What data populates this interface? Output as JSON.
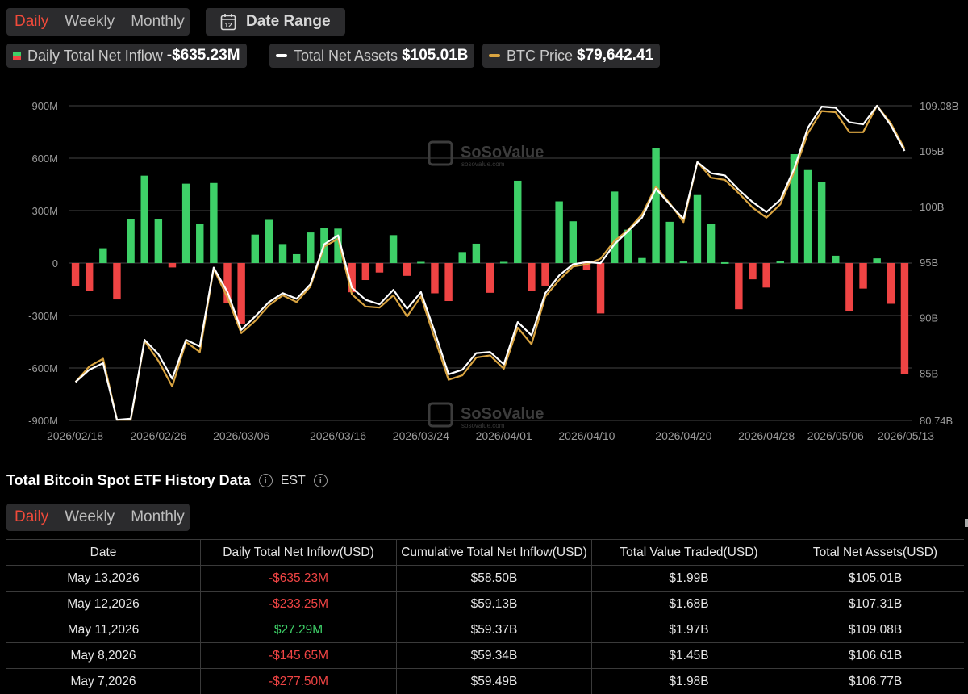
{
  "top_tabs": {
    "items": [
      "Daily",
      "Weekly",
      "Monthly"
    ],
    "active": "Daily"
  },
  "date_range": {
    "label": "Date Range",
    "icon": "calendar-icon",
    "icon_text": "12"
  },
  "legend": {
    "inflow": {
      "label": "Daily Total Net Inflow",
      "value": "-$635.23M"
    },
    "assets": {
      "label": "Total Net Assets",
      "value": "$105.01B"
    },
    "btc": {
      "label": "BTC Price",
      "value": "$79,642.41"
    }
  },
  "watermark": {
    "brand": "SoSoValue",
    "url": "sosovalue.com"
  },
  "colors": {
    "positive": "#3ed068",
    "negative": "#ef4444",
    "assets_line": "#ffffff",
    "btc_line": "#d9a441",
    "grid": "#444444"
  },
  "chart_data": {
    "type": "bar",
    "combo": "bars with two lines on secondary axis",
    "x_tick_labels": [
      "2026/02/18",
      "2026/02/26",
      "2026/03/06",
      "2026/03/16",
      "2026/03/24",
      "2026/04/01",
      "2026/04/10",
      "2026/04/20",
      "2026/04/28",
      "2026/05/06",
      "2026/05/13"
    ],
    "y_left_ticks": [
      "900M",
      "600M",
      "300M",
      "0",
      "-300M",
      "-600M",
      "-900M"
    ],
    "y_right_ticks": [
      "109.08B",
      "105B",
      "100B",
      "95B",
      "90B",
      "85B",
      "80.74B"
    ],
    "y_left_range_millions": [
      -900,
      900
    ],
    "y_right_range_billions": [
      80.74,
      109.08
    ],
    "grid": true,
    "series": [
      {
        "name": "Daily Total Net Inflow",
        "kind": "bar",
        "unit": "M USD",
        "values": [
          -133,
          -158,
          85,
          -208,
          253,
          500,
          251,
          -25,
          454,
          225,
          458,
          -229,
          -346,
          163,
          247,
          109,
          51,
          175,
          202,
          197,
          -167,
          -97,
          -54,
          160,
          -73,
          7,
          -173,
          -217,
          63,
          111,
          -170,
          7,
          471,
          -160,
          -129,
          353,
          239,
          -38,
          -288,
          409,
          191,
          29,
          658,
          236,
          9,
          389,
          224,
          5,
          -264,
          -93,
          -140,
          10,
          623,
          532,
          463,
          42,
          -277,
          -146,
          27,
          -233,
          -635
        ]
      },
      {
        "name": "Total Net Assets",
        "kind": "line",
        "unit": "B USD",
        "values": [
          84.2,
          85.3,
          85.9,
          80.8,
          80.9,
          88.0,
          86.7,
          84.5,
          88.0,
          87.4,
          94.5,
          92.3,
          88.9,
          90.1,
          91.4,
          92.2,
          91.7,
          93.0,
          96.6,
          97.4,
          92.7,
          91.6,
          91.2,
          92.5,
          90.8,
          92.3,
          88.7,
          84.9,
          85.3,
          86.8,
          86.9,
          85.8,
          89.6,
          88.4,
          92.2,
          93.8,
          94.8,
          95.0,
          94.9,
          96.6,
          97.8,
          99.0,
          101.6,
          100.2,
          98.9,
          104.0,
          103.0,
          102.8,
          101.5,
          100.4,
          99.5,
          100.6,
          103.4,
          107.1,
          109.0,
          108.9,
          107.6,
          107.4,
          109.08,
          107.31,
          105.01
        ]
      },
      {
        "name": "BTC Price",
        "kind": "line",
        "unit": "B (right axis scale)",
        "values": [
          84.2,
          85.6,
          86.3,
          80.8,
          80.8,
          87.9,
          86.1,
          83.8,
          87.8,
          86.9,
          94.4,
          91.8,
          88.6,
          89.7,
          91.1,
          92.0,
          91.4,
          92.8,
          96.4,
          97.1,
          92.1,
          91.0,
          90.9,
          92.0,
          90.1,
          91.9,
          88.1,
          84.4,
          84.8,
          86.4,
          86.6,
          85.4,
          89.1,
          87.6,
          91.9,
          93.4,
          94.6,
          94.8,
          95.3,
          96.9,
          97.9,
          99.3,
          101.8,
          100.3,
          98.6,
          104.0,
          102.6,
          102.4,
          101.2,
          99.9,
          99.0,
          100.2,
          103.1,
          106.6,
          108.6,
          108.5,
          106.7,
          106.7,
          109.08,
          107.5,
          105.2
        ]
      }
    ]
  },
  "table_section": {
    "title": "Total Bitcoin Spot ETF History Data",
    "timezone": "EST",
    "tabs": [
      "Daily",
      "Weekly",
      "Monthly"
    ],
    "active_tab": "Daily",
    "columns": [
      "Date",
      "Daily Total Net Inflow(USD)",
      "Cumulative Total Net Inflow(USD)",
      "Total Value Traded(USD)",
      "Total Net Assets(USD)"
    ],
    "rows": [
      {
        "date": "May 13,2026",
        "inflow": "-$635.23M",
        "sign": "neg",
        "cumulative": "$58.50B",
        "traded": "$1.99B",
        "assets": "$105.01B"
      },
      {
        "date": "May 12,2026",
        "inflow": "-$233.25M",
        "sign": "neg",
        "cumulative": "$59.13B",
        "traded": "$1.68B",
        "assets": "$107.31B"
      },
      {
        "date": "May 11,2026",
        "inflow": "$27.29M",
        "sign": "pos",
        "cumulative": "$59.37B",
        "traded": "$1.97B",
        "assets": "$109.08B"
      },
      {
        "date": "May 8,2026",
        "inflow": "-$145.65M",
        "sign": "neg",
        "cumulative": "$59.34B",
        "traded": "$1.45B",
        "assets": "$106.61B"
      },
      {
        "date": "May 7,2026",
        "inflow": "-$277.50M",
        "sign": "neg",
        "cumulative": "$59.49B",
        "traded": "$1.98B",
        "assets": "$106.77B"
      }
    ]
  }
}
